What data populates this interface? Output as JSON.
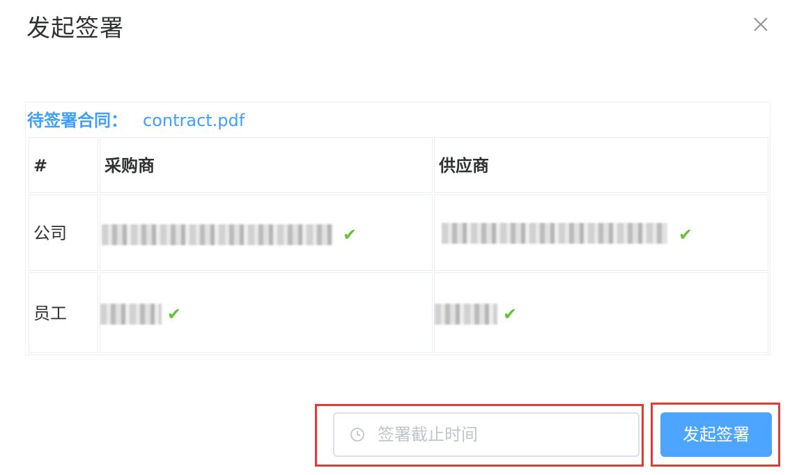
{
  "dialog": {
    "title": "发起签署",
    "close_icon": "close-icon"
  },
  "contract": {
    "label": "待签署合同：",
    "file_name": "contract.pdf"
  },
  "table": {
    "headers": [
      "#",
      "采购商",
      "供应商"
    ],
    "rows": [
      {
        "label": "公司",
        "purchaser_signed": true,
        "supplier_signed": true,
        "check_glyph": "✔"
      },
      {
        "label": "员工",
        "purchaser_signed": true,
        "supplier_signed": true,
        "check_glyph": "✔"
      }
    ]
  },
  "footer": {
    "deadline_placeholder": "签署截止时间",
    "deadline_icon": "clock-icon",
    "submit_label": "发起签署"
  },
  "colors": {
    "accent": "#409eff",
    "success": "#67c23a",
    "highlight": "#e53935"
  }
}
